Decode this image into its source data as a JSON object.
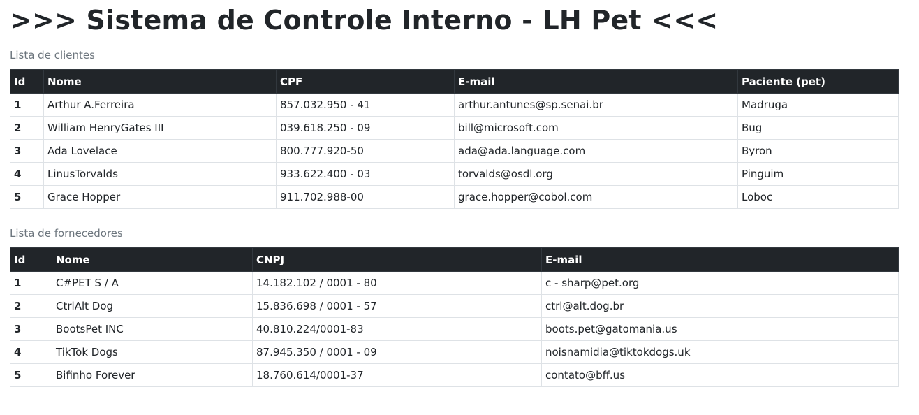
{
  "page": {
    "title": ">>> Sistema de Controle Interno - LH Pet <<<"
  },
  "clientes": {
    "caption": "Lista de clientes",
    "headers": [
      "Id",
      "Nome",
      "CPF",
      "E-mail",
      "Paciente (pet)"
    ],
    "rows": [
      [
        "1",
        "Arthur A.Ferreira",
        "857.032.950 - 41",
        "arthur.antunes@sp.senai.br",
        "Madruga"
      ],
      [
        "2",
        "William HenryGates III",
        "039.618.250 - 09",
        "bill@microsoft.com",
        "Bug"
      ],
      [
        "3",
        "Ada Lovelace",
        "800.777.920-50",
        "ada@ada.language.com",
        "Byron"
      ],
      [
        "4",
        "LinusTorvalds",
        "933.622.400 - 03",
        "torvalds@osdl.org",
        "Pinguim"
      ],
      [
        "5",
        "Grace Hopper",
        "911.702.988-00",
        "grace.hopper@cobol.com",
        "Loboc"
      ]
    ]
  },
  "fornecedores": {
    "caption": "Lista de fornecedores",
    "headers": [
      "Id",
      "Nome",
      "CNPJ",
      "E-mail"
    ],
    "rows": [
      [
        "1",
        "C#PET S / A",
        "14.182.102 / 0001 - 80",
        "c - sharp@pet.org"
      ],
      [
        "2",
        "CtrlAlt Dog",
        "15.836.698 / 0001 - 57",
        "ctrl@alt.dog.br"
      ],
      [
        "3",
        "BootsPet INC",
        "40.810.224/0001-83",
        "boots.pet@gatomania.us"
      ],
      [
        "4",
        "TikTok Dogs",
        "87.945.350 / 0001 - 09",
        "noisnamidia@tiktokdogs.uk"
      ],
      [
        "5",
        "Bifinho Forever",
        "18.760.614/0001-37",
        "contato@bff.us"
      ]
    ]
  }
}
